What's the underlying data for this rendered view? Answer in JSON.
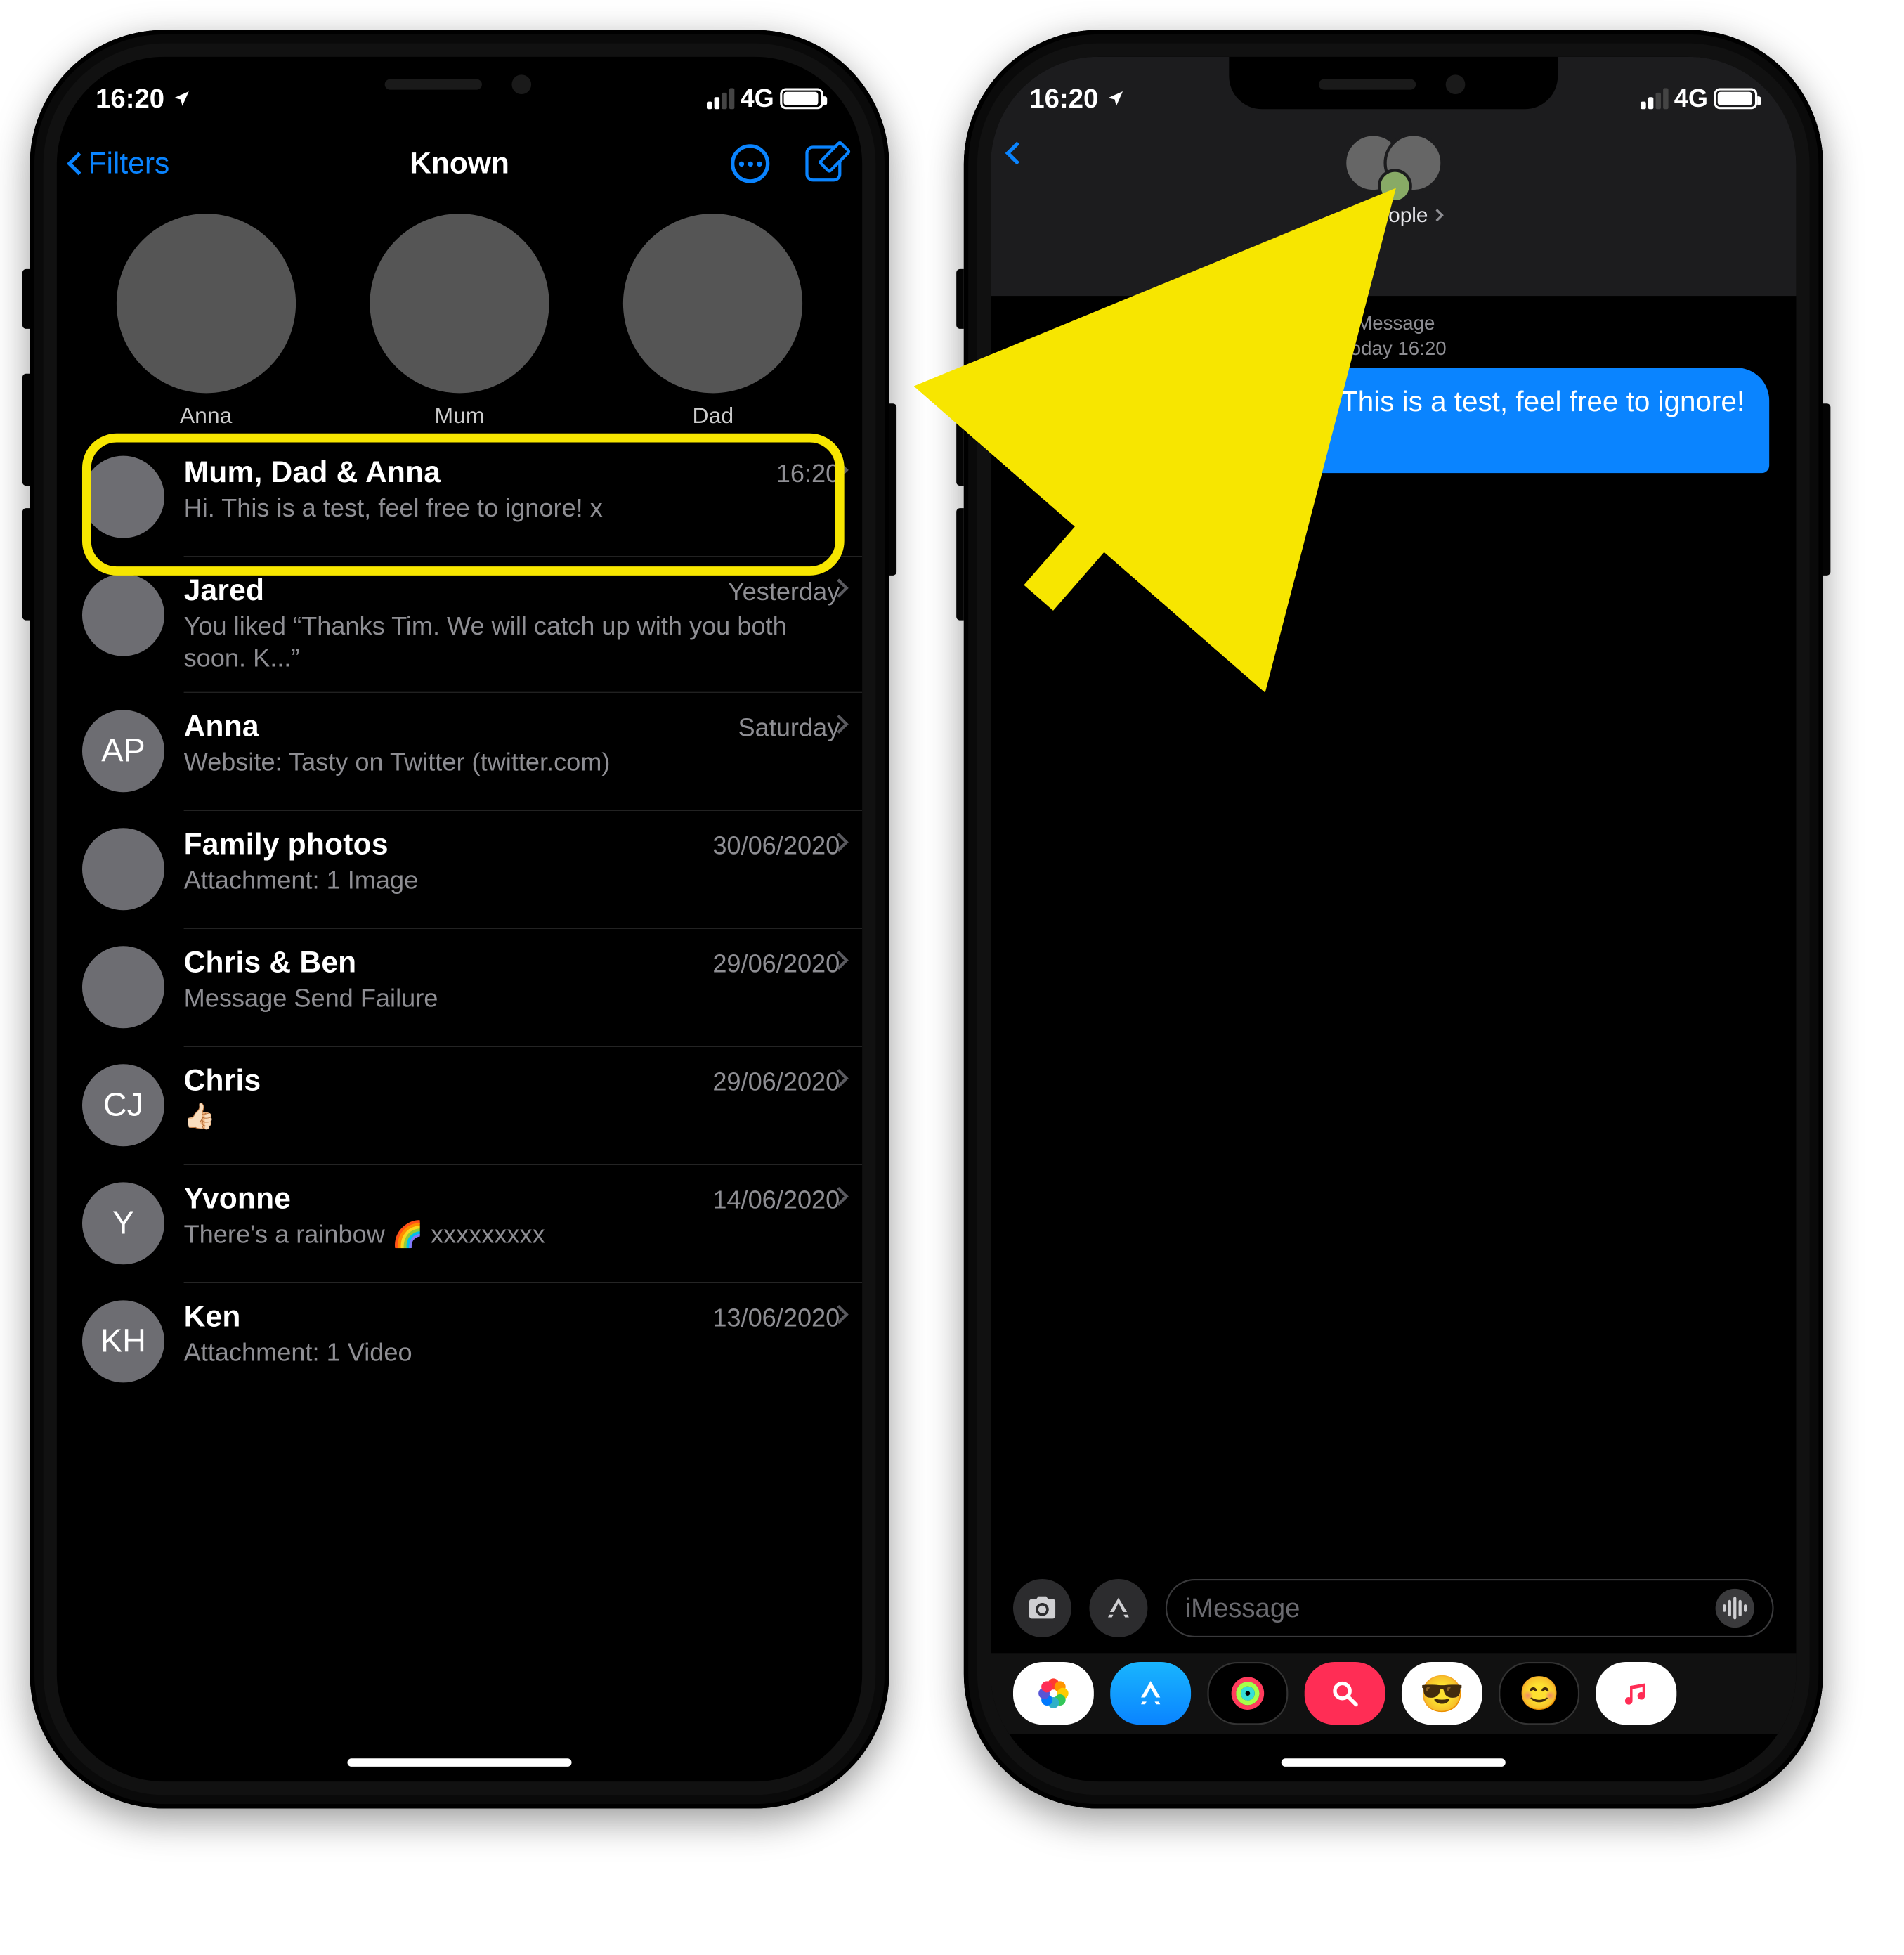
{
  "status": {
    "time": "16:20",
    "network": "4G"
  },
  "screen1": {
    "nav": {
      "back": "Filters",
      "title": "Known"
    },
    "pins": [
      {
        "name": "Anna"
      },
      {
        "name": "Mum"
      },
      {
        "name": "Dad"
      }
    ],
    "rows": [
      {
        "title": "Mum, Dad & Anna",
        "time": "16:20",
        "sub": "Hi. This is a test, feel free to ignore! x",
        "avatar": "group"
      },
      {
        "title": "Jared",
        "time": "Yesterday",
        "sub": "You liked “Thanks Tim. We will catch up with you both soon. K...”",
        "avatar": "jared"
      },
      {
        "title": "Anna",
        "time": "Saturday",
        "sub": "Website: Tasty on Twitter (twitter.com)",
        "avatar": "AP"
      },
      {
        "title": "Family photos",
        "time": "30/06/2020",
        "sub": "Attachment: 1 Image",
        "avatar": "emoji"
      },
      {
        "title": "Chris & Ben",
        "time": "29/06/2020",
        "sub": "Message Send Failure",
        "avatar": "group"
      },
      {
        "title": "Chris",
        "time": "29/06/2020",
        "sub": "👍🏻",
        "avatar": "CJ"
      },
      {
        "title": "Yvonne",
        "time": "14/06/2020",
        "sub": "There's a rainbow 🌈 xxxxxxxxx",
        "avatar": "Y"
      },
      {
        "title": "Ken",
        "time": "13/06/2020",
        "sub": "Attachment: 1 Video",
        "avatar": "KH"
      }
    ]
  },
  "screen2": {
    "header_title": "3 People",
    "meta_type": "iMessage",
    "meta_time": "Today 16:20",
    "bubble": "Hi. This is a test, feel free to ignore! x",
    "placeholder": "iMessage"
  }
}
